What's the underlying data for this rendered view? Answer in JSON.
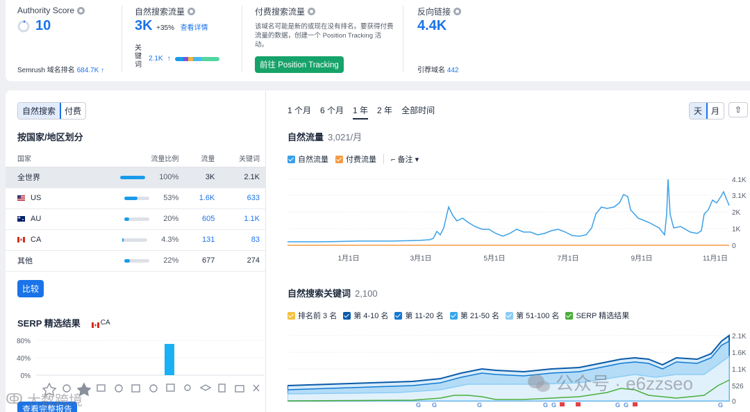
{
  "overview": {
    "authority": {
      "label": "Authority Score",
      "value": "10",
      "rank_label": "Semrush 域名排名",
      "rank_value": "684.7K",
      "rank_arrow": "↑"
    },
    "organic": {
      "label": "自然搜索流量",
      "value": "3K",
      "change": "+35%",
      "link": "查看详情",
      "kw_label": "关\n键\n词",
      "kw_value": "2.1K",
      "kw_arrow": "↑"
    },
    "paid": {
      "label": "付费搜索流量",
      "desc": "该域名可能是新的或现在没有排名。要获得付费流量的数据，创建一个 Position Tracking 活动。",
      "button": "前往 Position Tracking"
    },
    "backlinks": {
      "label": "反向链接",
      "value": "4.4K",
      "ref_label": "引荐域名",
      "ref_value": "442"
    }
  },
  "left": {
    "toggle": [
      "自然搜索",
      "付费"
    ],
    "geo_title": "按国家/地区划分",
    "geo_headers": [
      "国家",
      "流量比例",
      "流量",
      "关键词"
    ],
    "geo_rows": [
      {
        "country": "全世界",
        "share": "100%",
        "share_fill": 1.0,
        "traffic": "3K",
        "keywords": "2.1K",
        "link": false,
        "selected": true
      },
      {
        "country": "US",
        "share": "53%",
        "share_fill": 0.53,
        "traffic": "1.6K",
        "keywords": "633",
        "link": true,
        "flag": "us"
      },
      {
        "country": "AU",
        "share": "20%",
        "share_fill": 0.2,
        "traffic": "605",
        "keywords": "1.1K",
        "link": true,
        "flag": "au"
      },
      {
        "country": "CA",
        "share": "4.3%",
        "share_fill": 0.043,
        "traffic": "131",
        "keywords": "83",
        "link": true,
        "flag": "ca"
      },
      {
        "country": "其他",
        "share": "22%",
        "share_fill": 0.22,
        "traffic": "677",
        "keywords": "274",
        "link": false
      }
    ],
    "compare": "比较",
    "serp_title": "SERP 精选结果",
    "serp_country": "CA",
    "serp_y": [
      "80%",
      "40%",
      "0%"
    ],
    "serp_button": "查看完整报告"
  },
  "right": {
    "periods": [
      "1 个月",
      "6 个月",
      "1 年",
      "2 年",
      "全部时间"
    ],
    "active_period": "1 年",
    "granularity": [
      "天",
      "月"
    ],
    "traffic_title": "自然流量",
    "traffic_sub": "3,021/月",
    "traffic_legend": [
      "自然流量",
      "付费流量"
    ],
    "notes": "备注",
    "traffic_yticks": [
      "4.1K",
      "3.1K",
      "2K",
      "1K",
      "0"
    ],
    "xticks": [
      "1月1日",
      "3月1日",
      "5月1日",
      "7月1日",
      "9月1日",
      "11月1日"
    ],
    "kw_title": "自然搜索关键词",
    "kw_sub": "2,100",
    "kw_legend": [
      "排名前 3 名",
      "第 4-10 名",
      "第 11-20 名",
      "第 21-50 名",
      "第 51-100 名",
      "SERP 精选结果"
    ],
    "kw_yticks": [
      "2.1K",
      "1.6K",
      "1.1K",
      "526",
      "0"
    ]
  },
  "colors": {
    "accent": "#1a73e8",
    "organic": "#3aa0e8",
    "paid": "#f59b45",
    "green": "#16a369"
  },
  "watermark": {
    "wechat": "公众号 · e6zzseo",
    "brand": "大数跨境"
  }
}
